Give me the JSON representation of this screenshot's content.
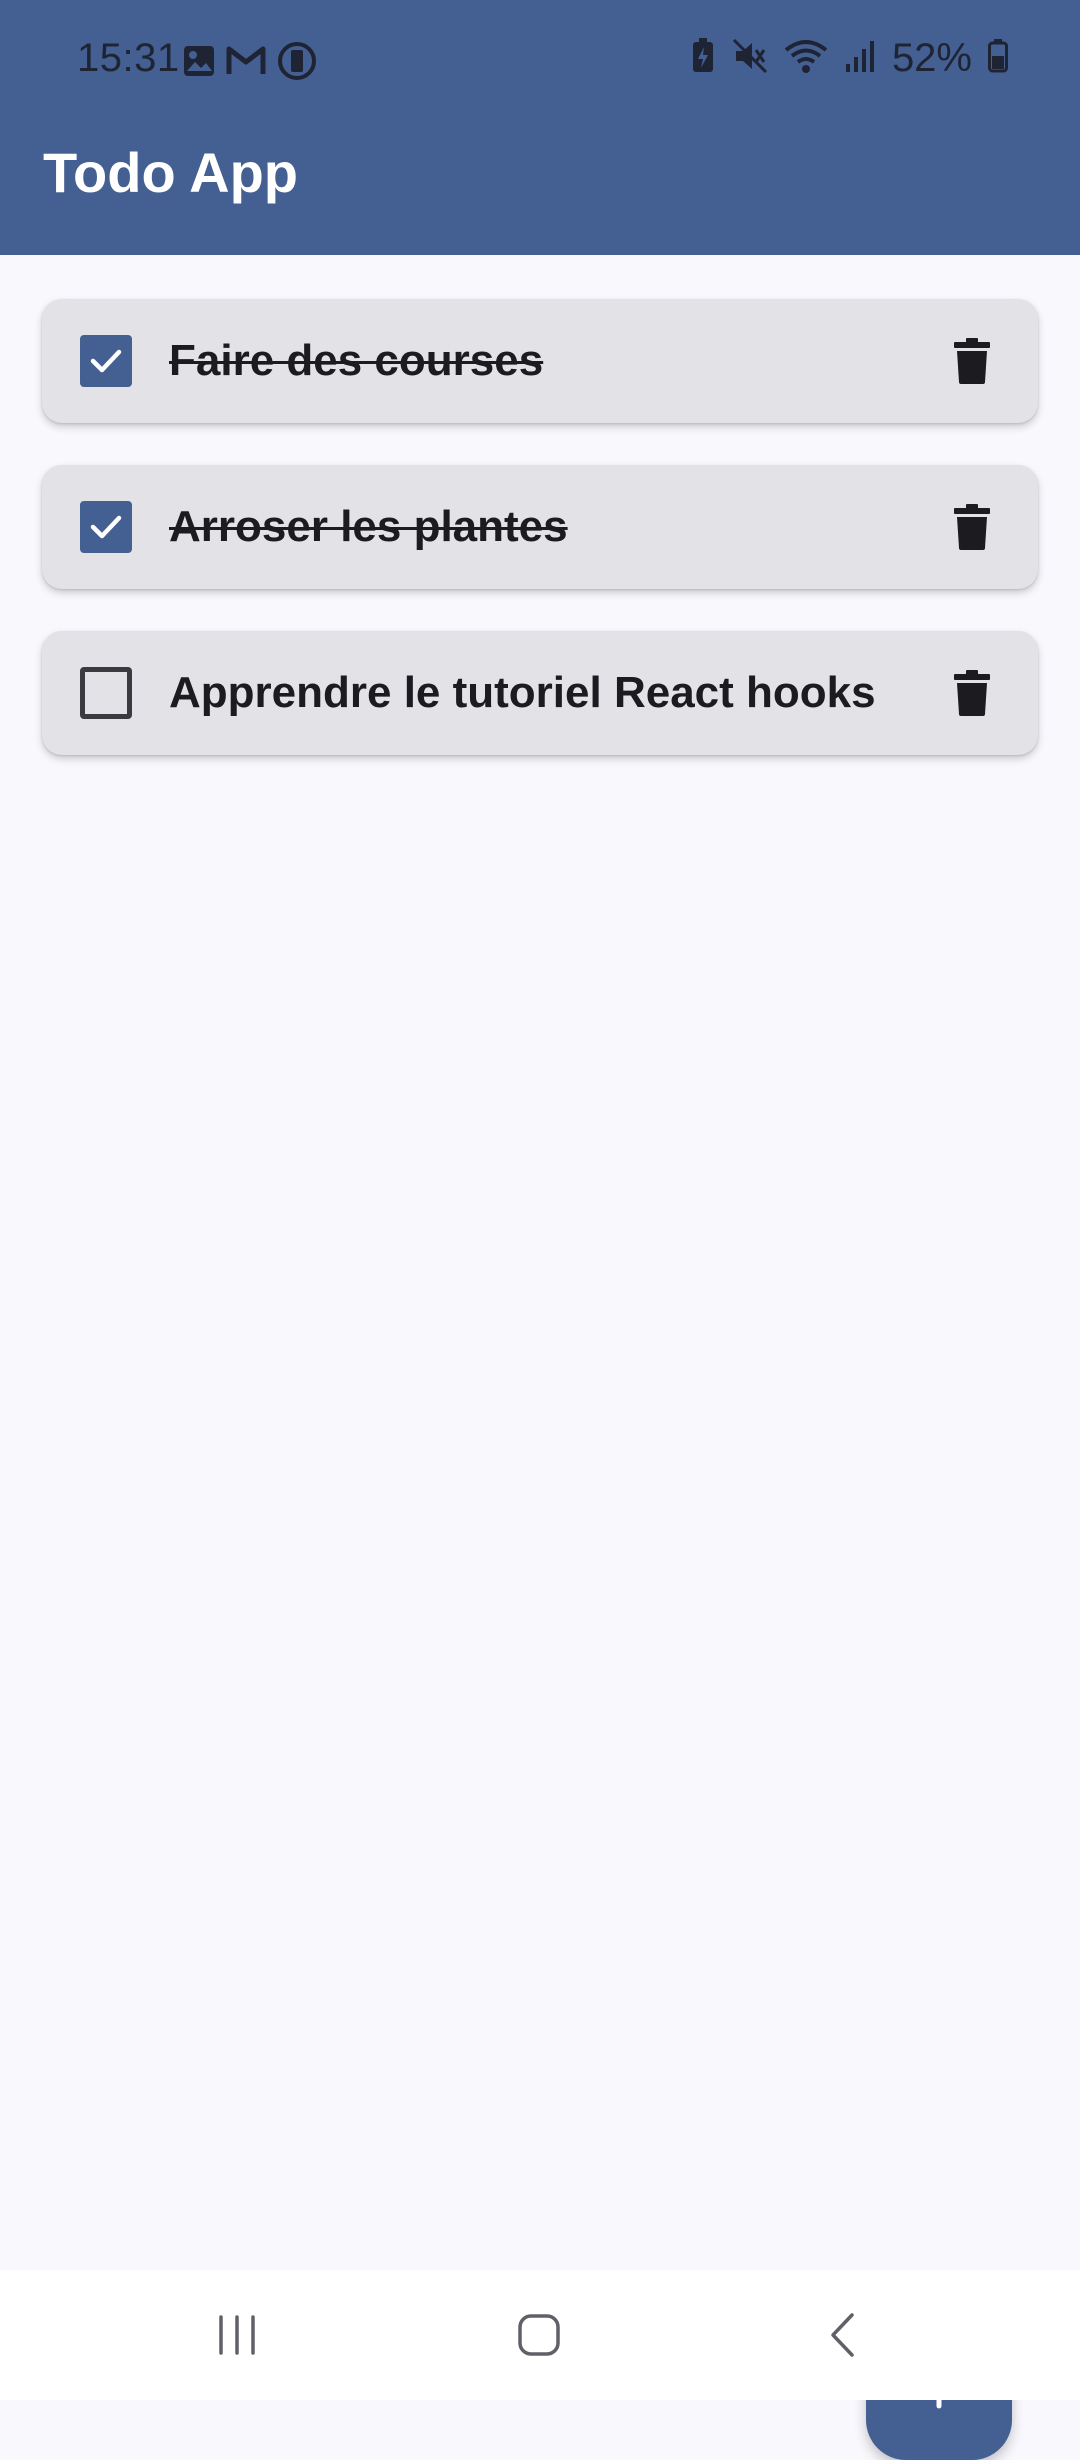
{
  "status_bar": {
    "time": "15:31",
    "battery_percent": "52%",
    "left_icons": [
      "gallery-icon",
      "gmail-icon",
      "battery-saver-icon"
    ],
    "right_icons": [
      "battery-charging-icon",
      "mute-icon",
      "wifi-icon",
      "signal-icon",
      "battery-icon"
    ]
  },
  "app_bar": {
    "title": "Todo App"
  },
  "todos": [
    {
      "label": "Faire des courses",
      "done": true
    },
    {
      "label": "Arroser les plantes",
      "done": true
    },
    {
      "label": "Apprendre le tutoriel React hooks",
      "done": false
    }
  ],
  "fab": {
    "icon": "plus-icon"
  },
  "nav_bar": {
    "buttons": [
      "recents-icon",
      "home-icon",
      "back-icon"
    ]
  },
  "colors": {
    "primary": "#445f91",
    "card": "#e3e2e7",
    "background": "#f8f8fd",
    "text": "#1c1b20"
  }
}
